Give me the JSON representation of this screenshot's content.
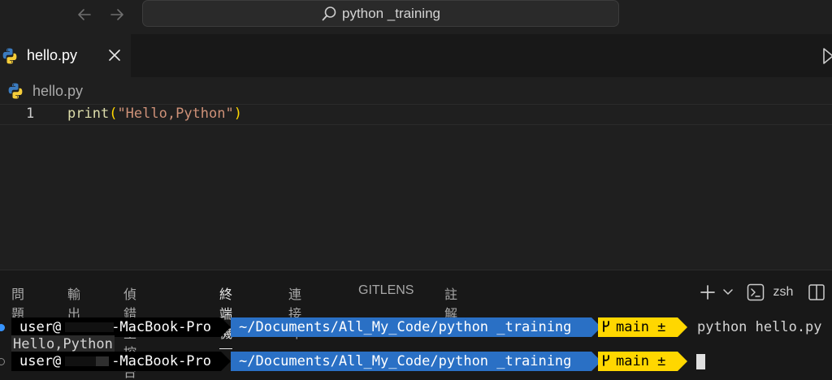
{
  "titlebar": {
    "back_icon": "arrow-left-icon",
    "forward_icon": "arrow-right-icon",
    "search_text": "python _training"
  },
  "tabs": [
    {
      "label": "hello.py",
      "icon": "python-icon",
      "active": true
    }
  ],
  "editor": {
    "breadcrumb": "hello.py",
    "lines": [
      {
        "number": "1",
        "fn": "print",
        "open": "(",
        "str": "\"Hello,Python\"",
        "close": ")"
      }
    ]
  },
  "panel": {
    "tabs": [
      "問題",
      "輸出",
      "偵錯主控台",
      "終端機",
      "連接埠",
      "GITLENS",
      "註解"
    ],
    "active_tab": "終端機",
    "shell": "zsh"
  },
  "terminal": {
    "prompt_user_prefix": "user@",
    "prompt_host_suffix": "-MacBook-Pro",
    "prompt_path": "~/Documents/All_My_Code/python _training",
    "prompt_branch": "main ±",
    "command": "python hello.py",
    "output": "Hello,Python"
  },
  "colors": {
    "path_segment": "#2a70c5",
    "git_segment": "#ffd700",
    "underline": "#e8374c",
    "string": "#ce9178"
  }
}
